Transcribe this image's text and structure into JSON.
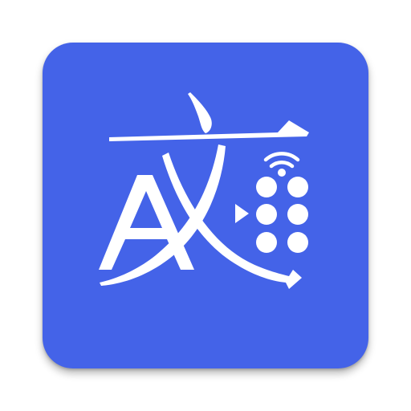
{
  "app_icon": {
    "tile_color": "#4463E8",
    "glyph_color": "#FFFFFF",
    "logo_letters": [
      "A",
      "文"
    ],
    "icon_names": [
      "letter-a-glyph",
      "kanji-wen-glyph",
      "play-arrow-icon",
      "wifi-signal-icon",
      "braille-cell-icon"
    ]
  }
}
